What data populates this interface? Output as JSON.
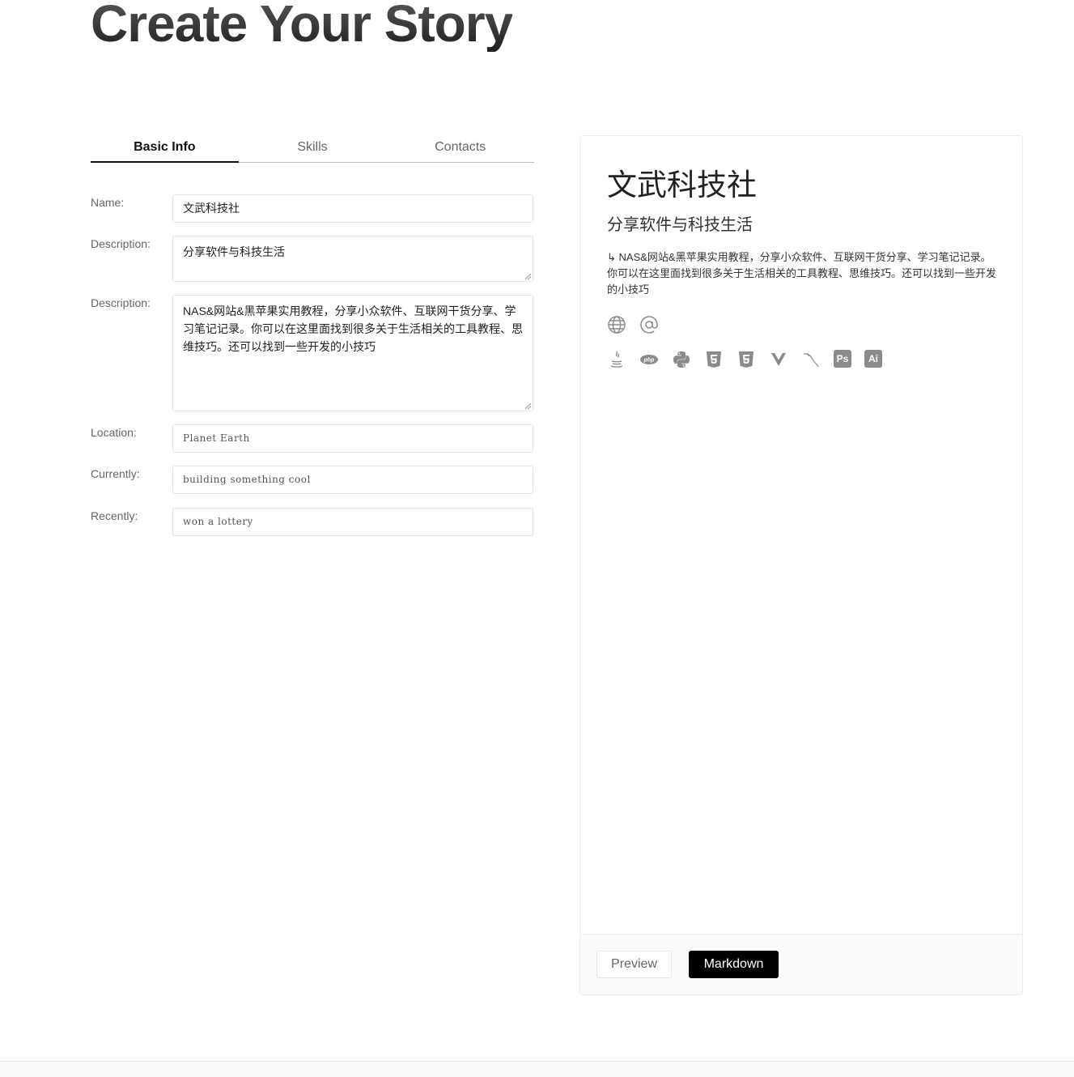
{
  "page": {
    "title": "Create Your Story"
  },
  "tabs": [
    {
      "label": "Basic Info",
      "active": true
    },
    {
      "label": "Skills",
      "active": false
    },
    {
      "label": "Contacts",
      "active": false
    }
  ],
  "form": {
    "name": {
      "label": "Name:",
      "value": "文武科技社"
    },
    "description": {
      "label": "Description:",
      "value": "分享软件与科技生活"
    },
    "bio": {
      "label": "Description:",
      "value": "NAS&网站&黑苹果实用教程，分享小众软件、互联网干货分享、学习笔记记录。你可以在这里面找到很多关于生活相关的工具教程、思维技巧。还可以找到一些开发的小技巧"
    },
    "location": {
      "label": "Location:",
      "placeholder": "Planet Earth"
    },
    "currently": {
      "label": "Currently:",
      "placeholder": "building something cool"
    },
    "recently": {
      "label": "Recently:",
      "placeholder": "won a lottery"
    }
  },
  "preview": {
    "name": "文武科技社",
    "description": "分享软件与科技生活",
    "bio": "↳ NAS&网站&黑苹果实用教程，分享小众软件、互联网干货分享、学习笔记记录。你可以在这里面找到很多关于生活相关的工具教程、思维技巧。还可以找到一些开发的小技巧",
    "contact_icons": [
      "globe-icon",
      "at-icon"
    ],
    "skill_icons": [
      "java-icon",
      "php-icon",
      "python-icon",
      "html5-icon",
      "css3-icon",
      "vue-icon",
      "mysql-icon",
      "photoshop-icon",
      "illustrator-icon"
    ],
    "ps_label": "Ps",
    "ai_label": "Ai",
    "php_label": "php"
  },
  "footer": {
    "preview_label": "Preview",
    "markdown_label": "Markdown"
  },
  "colors": {
    "icon": "#8a8a8a",
    "button_active": "#000000"
  }
}
